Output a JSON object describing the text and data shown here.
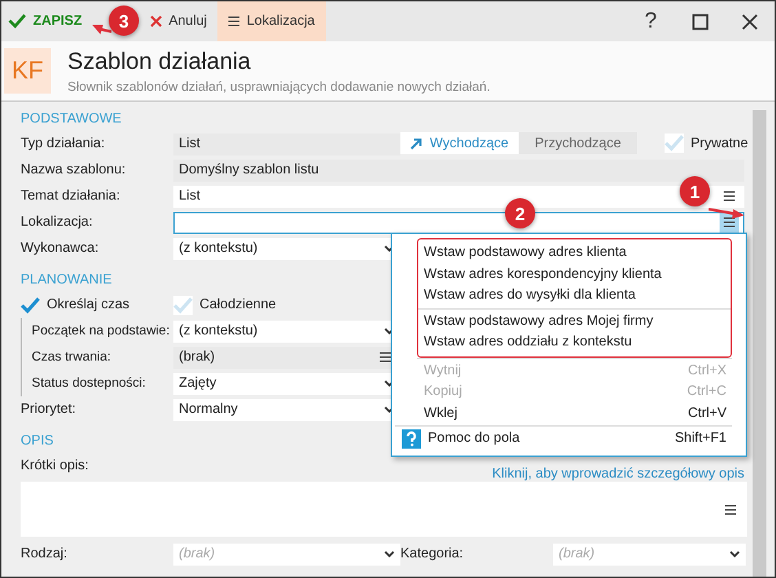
{
  "toolbar": {
    "buttons": [
      {
        "label": "ZAPISZ",
        "kind": "save"
      },
      {
        "label": "Anuluj",
        "kind": "cancel"
      },
      {
        "label": "Lokalizacja",
        "kind": "menu",
        "selected": true
      }
    ],
    "save_callout": "3",
    "help": "?"
  },
  "header": {
    "logo": "KF",
    "title": "Szablon działania",
    "subtitle": "Słownik szablonów działań, usprawniających dodawanie nowych działań."
  },
  "basic": {
    "heading": "PODSTAWOWE",
    "fields": [
      {
        "label": "Typ działania:",
        "value": "List",
        "kind": "readonly"
      },
      {
        "label": "Nazwa szablonu:",
        "value": "Domyślny szablon listu",
        "kind": "readonly_wide"
      },
      {
        "label": "Temat działania:",
        "value": "List",
        "kind": "menu_wide"
      },
      {
        "label": "Lokalizacja:",
        "kind": "menu_wide",
        "focused": true,
        "button_callout": "1",
        "field_callout": "2"
      },
      {
        "label": "Wykonawca:",
        "value": "(z kontekstu)",
        "kind": "select"
      }
    ],
    "direction": [
      {
        "label": "Wychodzące",
        "selected": true
      },
      {
        "label": "Przychodzące",
        "selected": false
      }
    ],
    "private": {
      "label": "Prywatne",
      "checked": false
    }
  },
  "planning": {
    "heading": "PLANOWANIE",
    "checks": [
      {
        "label": "Określaj czas",
        "checked": true
      },
      {
        "label": "Całodzienne",
        "checked": false
      }
    ],
    "detail_fields": [
      {
        "label": "Początek na podstawie:",
        "value": "(z kontekstu)",
        "kind": "select"
      },
      {
        "label": "Czas trwania:",
        "value": "(brak)",
        "kind": "menu_readonly"
      },
      {
        "label": "Status dostepności:",
        "value": "Zajęty",
        "kind": "select"
      }
    ],
    "priority": {
      "label": "Priorytet:",
      "value": "Normalny",
      "kind": "select"
    }
  },
  "description": {
    "heading": "OPIS",
    "label": "Krótki opis:",
    "hint": "Kliknij, aby wprowadzić szczegółowy opis"
  },
  "bottom": [
    {
      "label": "Rodzaj:",
      "placeholder": "(brak)"
    },
    {
      "label": "Kategoria:",
      "placeholder": "(brak)"
    }
  ],
  "context_menu": {
    "groups": [
      {
        "annotated": true,
        "items": [
          {
            "label": "Wstaw podstawowy adres klienta",
            "disabled": false
          },
          {
            "label": "Wstaw adres korespondencyjny klienta",
            "disabled": false
          },
          {
            "label": "Wstaw adres do wysyłki dla klienta",
            "disabled": false
          }
        ]
      },
      {
        "annotated": true,
        "items": [
          {
            "label": "Wstaw podstawowy adres Mojej firmy",
            "disabled": false
          },
          {
            "label": "Wstaw adres oddziału z kontekstu",
            "disabled": false
          }
        ]
      },
      {
        "annotated": false,
        "items": [
          {
            "label": "Wytnij",
            "shortcut": "Ctrl+X",
            "disabled": true
          },
          {
            "label": "Kopiuj",
            "shortcut": "Ctrl+C",
            "disabled": true
          },
          {
            "label": "Wklej",
            "shortcut": "Ctrl+V",
            "disabled": false
          }
        ]
      },
      {
        "annotated": false,
        "items": [
          {
            "label": "Pomoc do pola",
            "shortcut": "Shift+F1",
            "disabled": false,
            "kind": "help"
          }
        ]
      }
    ]
  }
}
